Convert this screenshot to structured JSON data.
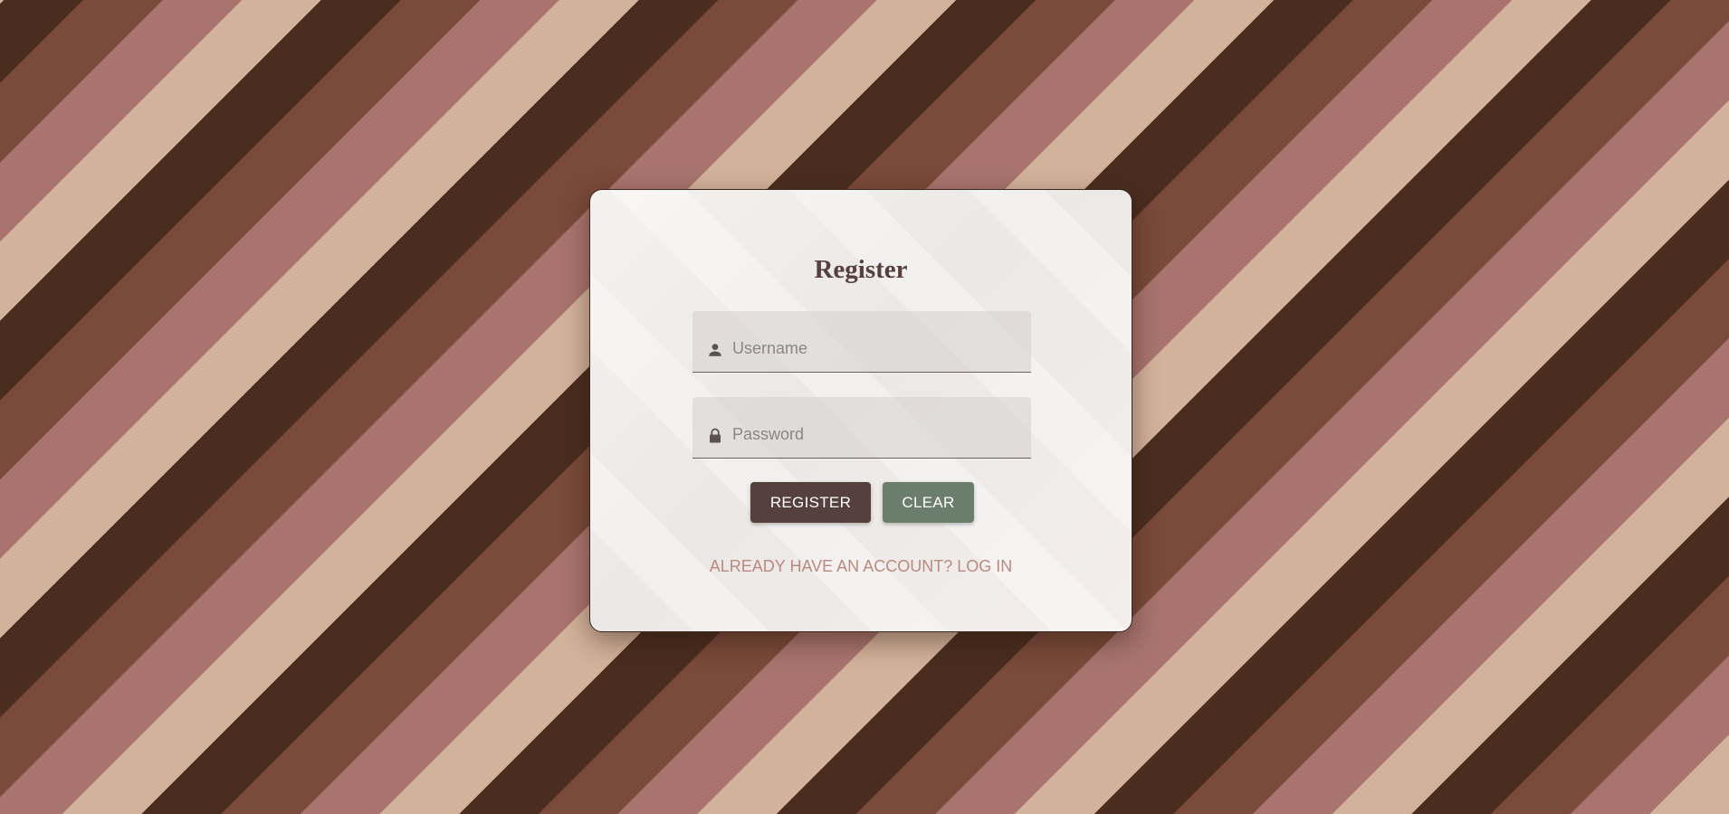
{
  "theme": {
    "stripe_colors": [
      "#d3b29b",
      "#a9746f",
      "#7a4a3a",
      "#4a2d1f"
    ],
    "title_color": "#55403d",
    "register_button_color": "#55403d",
    "clear_button_color": "#6b7e6b",
    "link_color": "#b98a80"
  },
  "form": {
    "title": "Register",
    "username": {
      "icon": "person-icon",
      "placeholder": "Username",
      "value": ""
    },
    "password": {
      "icon": "lock-icon",
      "placeholder": "Password",
      "value": ""
    },
    "register_label": "REGISTER",
    "clear_label": "CLEAR",
    "login_link": "ALREADY HAVE AN ACCOUNT? LOG IN"
  }
}
